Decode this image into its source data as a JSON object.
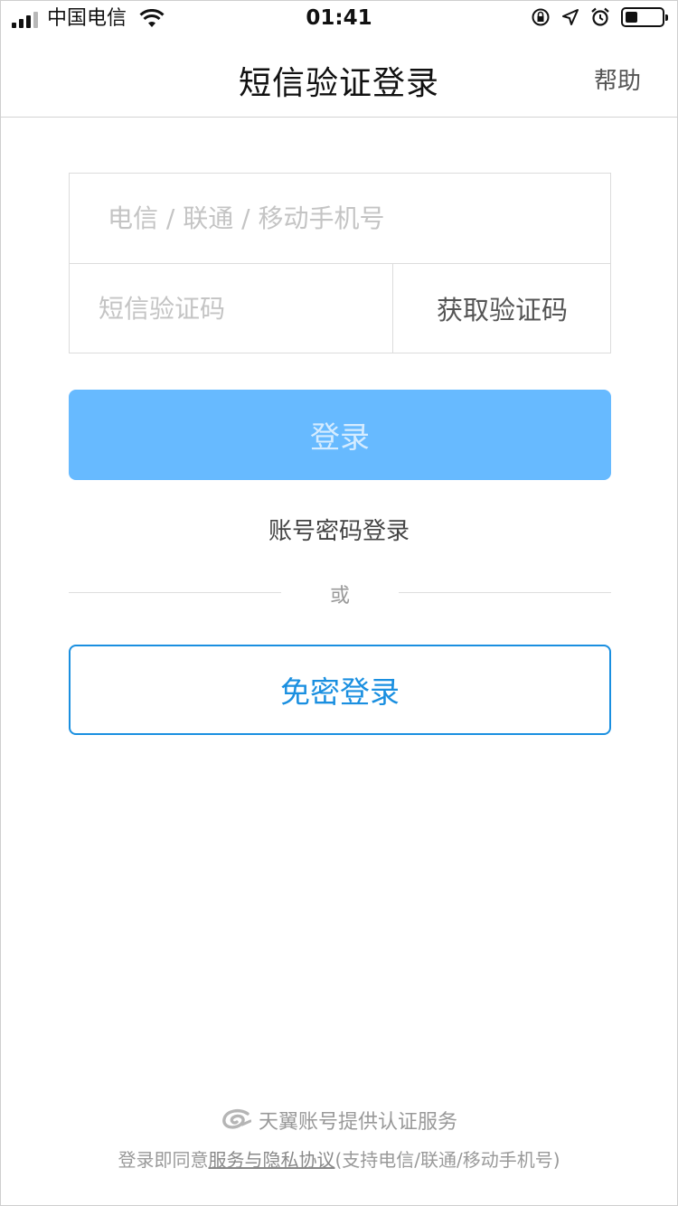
{
  "status_bar": {
    "carrier": "中国电信",
    "time": "01:41",
    "battery_level": 0.35
  },
  "nav": {
    "title": "短信验证登录",
    "help": "帮助"
  },
  "form": {
    "phone_placeholder": "电信 / 联通 / 移动手机号",
    "phone_value": "",
    "code_placeholder": "短信验证码",
    "code_value": "",
    "get_code": "获取验证码"
  },
  "login_button": "登录",
  "password_login": "账号密码登录",
  "divider_text": "或",
  "free_login_button": "免密登录",
  "footer": {
    "brand": "天翼账号提供认证服务",
    "terms_prefix": "登录即同意",
    "terms_link": "服务与隐私协议",
    "terms_suffix": "(支持电信/联通/移动手机号)"
  },
  "colors": {
    "primary": "#1a8fe0",
    "login_bg": "#67baff",
    "login_text": "#d5ecff"
  }
}
